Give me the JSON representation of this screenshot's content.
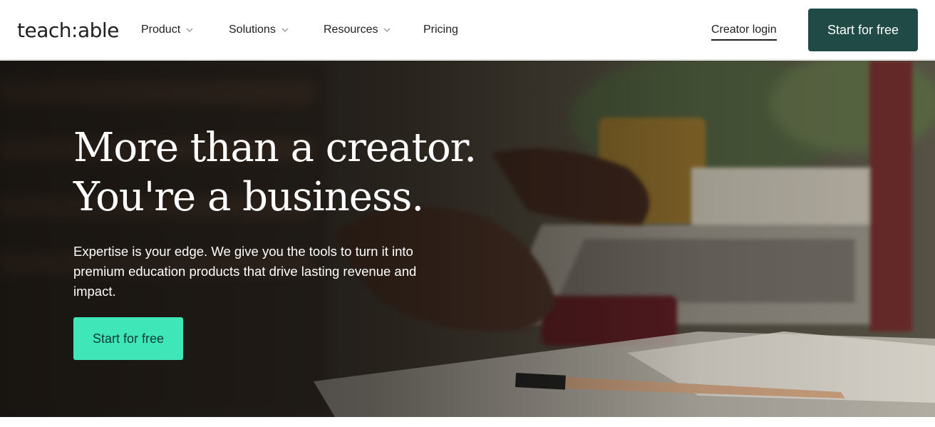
{
  "header": {
    "logo": "teach:able",
    "nav": [
      {
        "label": "Product",
        "has_dropdown": true
      },
      {
        "label": "Solutions",
        "has_dropdown": true
      },
      {
        "label": "Resources",
        "has_dropdown": true
      },
      {
        "label": "Pricing",
        "has_dropdown": false
      }
    ],
    "login_label": "Creator login",
    "cta_label": "Start for free",
    "icons": {
      "dropdown": "chevron-down-icon"
    }
  },
  "hero": {
    "headline_line1": "More than a creator.",
    "headline_line2": "You're a business.",
    "subtext": "Expertise is your edge. We give you the tools to turn it into premium education products that drive lasting revenue and impact.",
    "cta_label": "Start for free"
  },
  "colors": {
    "header_cta_bg": "#1f4a45",
    "hero_cta_bg": "#3ee6b8",
    "hero_cta_text": "#123a35"
  }
}
